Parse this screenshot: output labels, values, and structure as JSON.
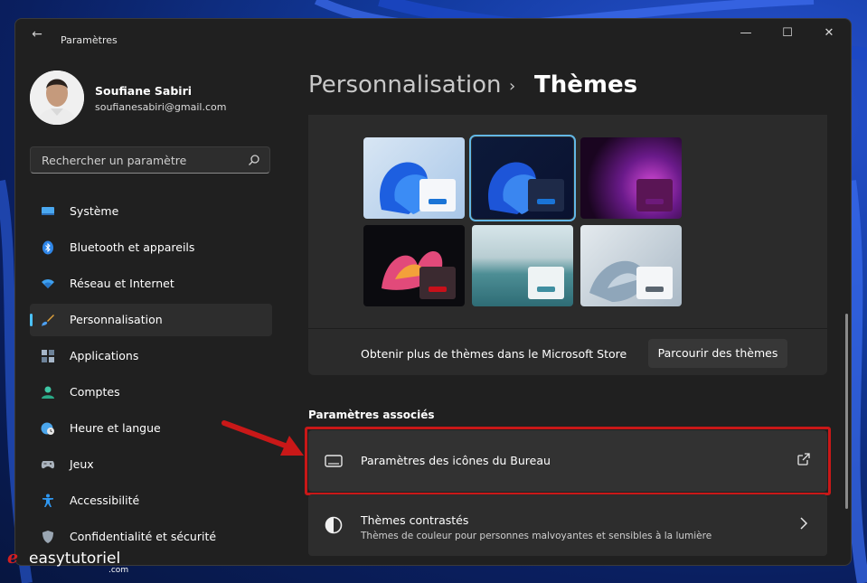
{
  "window": {
    "title": "Paramètres"
  },
  "profile": {
    "name": "Soufiane Sabiri",
    "email": "soufianesabiri@gmail.com"
  },
  "search": {
    "placeholder": "Rechercher un paramètre"
  },
  "sidebar": {
    "items": [
      {
        "label": "Système",
        "icon": "monitor-icon"
      },
      {
        "label": "Bluetooth et appareils",
        "icon": "bluetooth-icon"
      },
      {
        "label": "Réseau et Internet",
        "icon": "wifi-icon"
      },
      {
        "label": "Personnalisation",
        "icon": "brush-icon",
        "active": true
      },
      {
        "label": "Applications",
        "icon": "apps-icon"
      },
      {
        "label": "Comptes",
        "icon": "person-icon"
      },
      {
        "label": "Heure et langue",
        "icon": "globe-clock-icon"
      },
      {
        "label": "Jeux",
        "icon": "gamepad-icon"
      },
      {
        "label": "Accessibilité",
        "icon": "accessibility-icon"
      },
      {
        "label": "Confidentialité et sécurité",
        "icon": "shield-icon"
      }
    ]
  },
  "breadcrumb": {
    "parent": "Personnalisation",
    "separator": "›",
    "current": "Thèmes"
  },
  "themes": {
    "store_text": "Obtenir plus de thèmes dans le Microsoft Store",
    "browse_label": "Parcourir des thèmes",
    "tiles": [
      {
        "name": "windows-light",
        "selected": false,
        "accent": "#1a74d6"
      },
      {
        "name": "windows-dark",
        "selected": true,
        "accent": "#1a74d6"
      },
      {
        "name": "glow",
        "selected": false,
        "accent": "#6d1a7a"
      },
      {
        "name": "captured-motion",
        "selected": false,
        "accent": "#c8101a"
      },
      {
        "name": "sunrise",
        "selected": false,
        "accent": "#3f8ea0"
      },
      {
        "name": "flow",
        "selected": false,
        "accent": "#5a6570"
      }
    ]
  },
  "related": {
    "heading": "Paramètres associés",
    "desktop_icons": {
      "title": "Paramètres des icônes du Bureau",
      "icon": "external-link-icon"
    },
    "contrast": {
      "title": "Thèmes contrastés",
      "subtitle": "Thèmes de couleur pour personnes malvoyantes et sensibles à la lumière"
    }
  },
  "watermark": {
    "text": "easytutoriel",
    "domain": ".com"
  },
  "colors": {
    "accent": "#4cc2ff",
    "highlight": "#c91818"
  }
}
